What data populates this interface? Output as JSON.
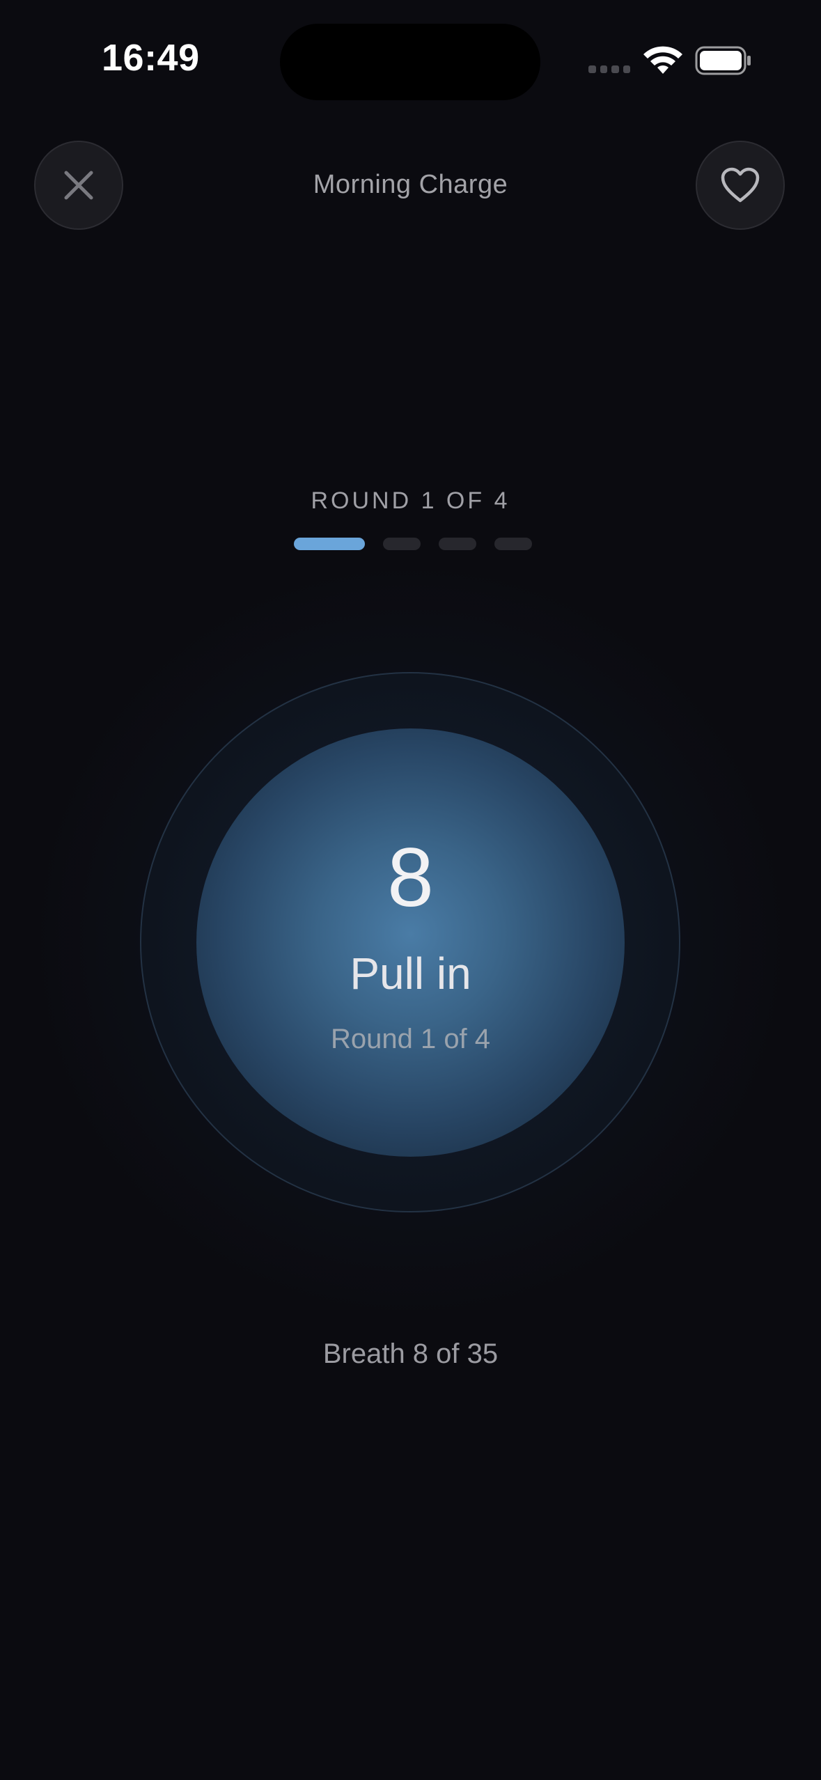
{
  "status_bar": {
    "time": "16:49"
  },
  "header": {
    "title": "Morning Charge",
    "close_icon": "close-icon",
    "favorite_icon": "heart-icon"
  },
  "session": {
    "round_label": "ROUND 1 OF 4",
    "current_round": 1,
    "total_rounds": 4,
    "accent_color": "#6aa5da"
  },
  "orb": {
    "count": "8",
    "phase": "Pull in",
    "round_text": "Round 1 of 4"
  },
  "footer": {
    "breath_counter": "Breath 8 of 35"
  }
}
